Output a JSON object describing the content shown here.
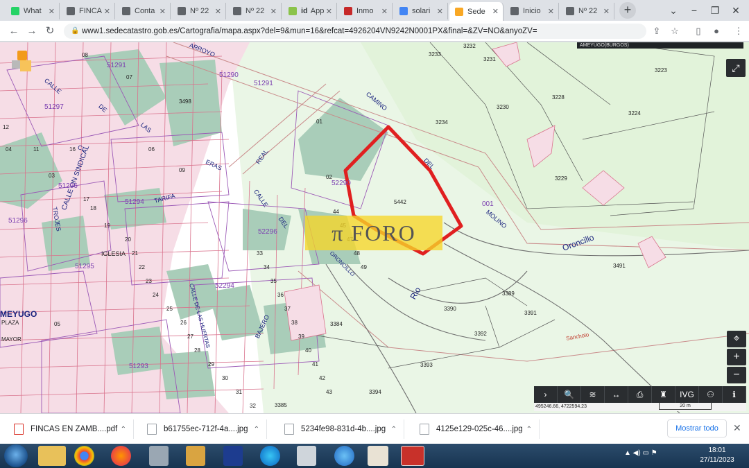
{
  "tabs": [
    {
      "title": "What",
      "color": "#25d366"
    },
    {
      "title": "FINCA",
      "color": "#5f6368"
    },
    {
      "title": "Conta",
      "color": "#5f6368"
    },
    {
      "title": "Nº 22",
      "color": "#5f6368"
    },
    {
      "title": "Nº 22",
      "color": "#5f6368"
    },
    {
      "title": "App -",
      "color": "#8bc34a",
      "prefix": "id"
    },
    {
      "title": "Inmo",
      "color": "#c62828"
    },
    {
      "title": "solari",
      "color": "#4285f4"
    },
    {
      "title": "Sede",
      "color": "#f9a825"
    },
    {
      "title": "Inicio",
      "color": "#5f6368"
    },
    {
      "title": "Nº 22",
      "color": "#5f6368"
    }
  ],
  "address": {
    "url": "www1.sedecatastro.gob.es/Cartografia/mapa.aspx?del=9&mun=16&refcat=4926204VN9242N0001PX&final=&ZV=NO&anyoZV="
  },
  "map": {
    "caption": "AMEYUGO(BURGOS)",
    "coords": "495246.66, 4722594.23",
    "scale": "20 m",
    "watermark": "π FORO",
    "tools": [
      "›",
      "🔍",
      "≋",
      "↔",
      "⎙",
      "♜",
      "IVG",
      "⚇",
      "ℹ"
    ],
    "zoom": [
      "⌖",
      "+",
      "−"
    ],
    "streets": [
      "ARROYO",
      "CALLE",
      "DE",
      "LAS",
      "ERAS",
      "CL",
      "TARIFA",
      "CALLE",
      "DEL",
      "MOLINO",
      "CAMINO",
      "DEL",
      "REAL",
      "ORONCILLO",
      "Oroncillo",
      "Rio",
      "Sancholo",
      "CALLE DE LAS HUERTAS",
      "IGLESIA",
      "PLAZA",
      "MAYOR",
      "MEYUGO",
      "BAJERO",
      "CALLE ON SINDICAL",
      "TROJES"
    ],
    "blocks": [
      "51291",
      "51290",
      "51291",
      "51297",
      "51296",
      "51294",
      "51296",
      "52290",
      "52296",
      "51295",
      "52294",
      "51293",
      "001"
    ],
    "parcels": [
      "3233",
      "3232",
      "3231",
      "3223",
      "3230",
      "3228",
      "3224",
      "3234",
      "3229",
      "5442",
      "3491",
      "3390",
      "3389",
      "3391",
      "3392",
      "3393",
      "3384",
      "3394",
      "3385",
      "3498",
      "08",
      "07",
      "02",
      "01",
      "03",
      "04",
      "05",
      "06",
      "09",
      "11",
      "12",
      "16",
      "17",
      "18",
      "19",
      "20",
      "21",
      "22",
      "23",
      "24",
      "25",
      "26",
      "27",
      "28",
      "29",
      "30",
      "31",
      "32",
      "33",
      "34",
      "35",
      "36",
      "37",
      "38",
      "39",
      "40",
      "41",
      "42",
      "43",
      "44",
      "45",
      "47",
      "48",
      "49"
    ]
  },
  "downloads": [
    {
      "name": "FINCAS EN ZAMB....pdf",
      "type": "pdf"
    },
    {
      "name": "b61755ec-712f-4a....jpg",
      "type": "jpg"
    },
    {
      "name": "5234fe98-831d-4b....jpg",
      "type": "jpg"
    },
    {
      "name": "4125e129-025c-46....jpg",
      "type": "jpg"
    }
  ],
  "downloads_show_all": "Mostrar todo",
  "taskbar": {
    "time": "18:01",
    "date": "27/11/2023",
    "tray": "▲ ◀) ▭ ⚑"
  }
}
